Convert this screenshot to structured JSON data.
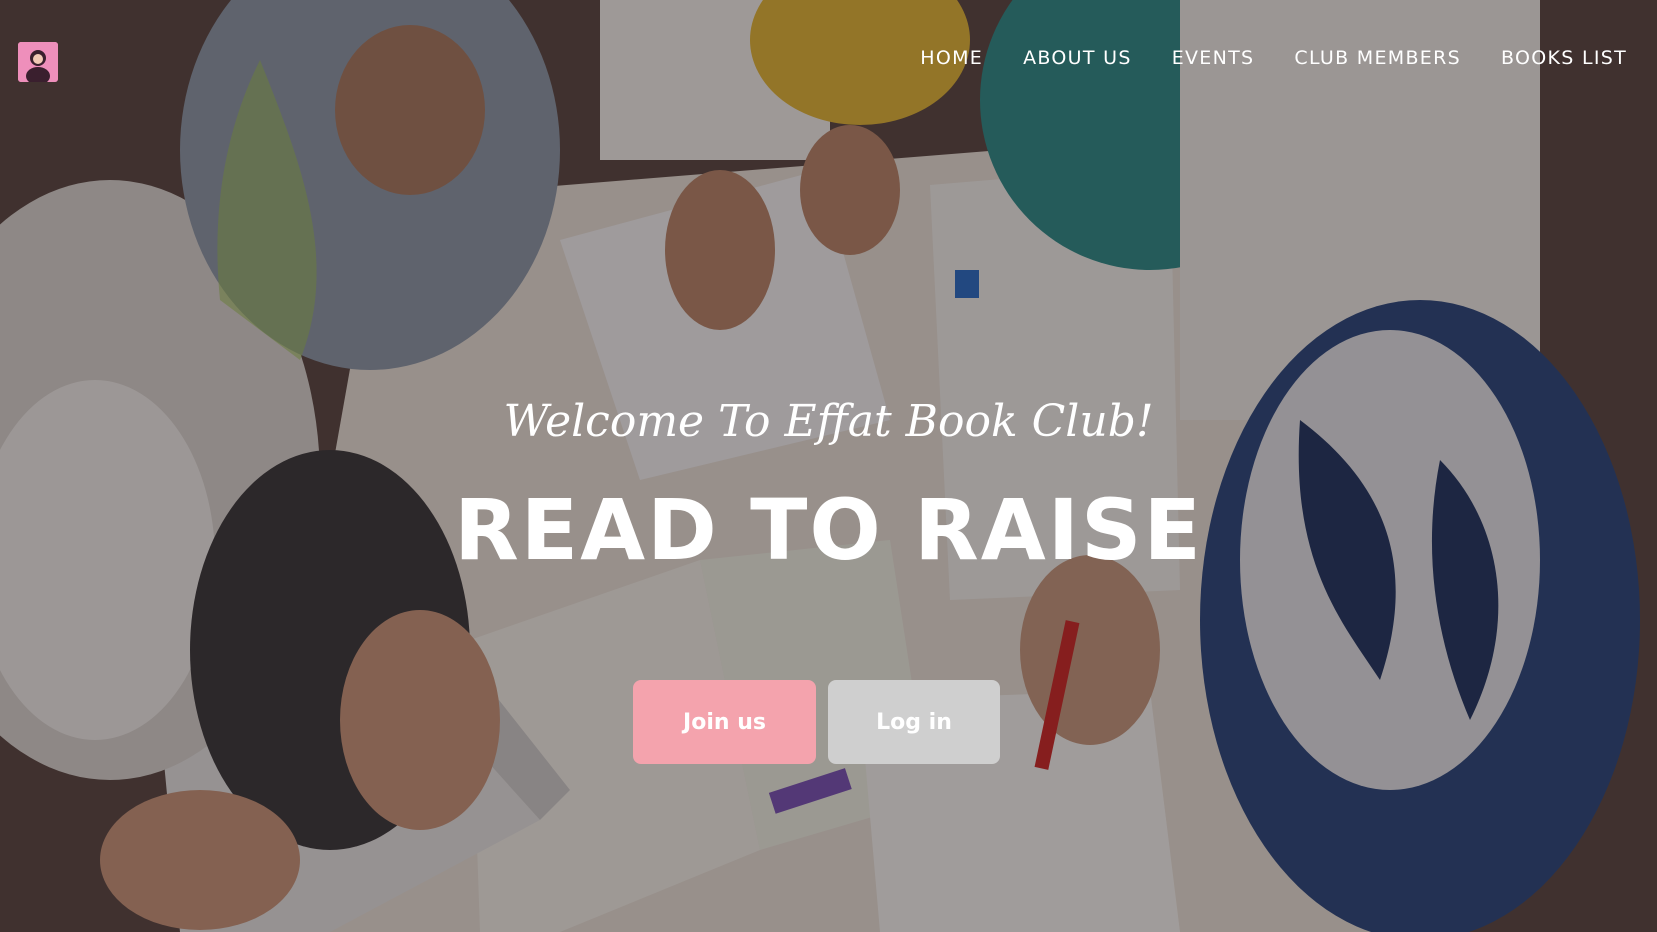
{
  "site": {
    "logo_icon": "profile-avatar-icon"
  },
  "nav": {
    "items": [
      {
        "label": "HOME"
      },
      {
        "label": "ABOUT US"
      },
      {
        "label": "EVENTS"
      },
      {
        "label": "CLUB MEMBERS"
      },
      {
        "label": "BOOKS LIST"
      }
    ]
  },
  "hero": {
    "welcome": "Welcome To Effat Book Club!",
    "headline": "READ TO RAISE",
    "join_label": "Join us",
    "login_label": "Log in"
  },
  "colors": {
    "join_button": "#f4a3ad",
    "login_button": "#cfcfcf",
    "text": "#ffffff"
  }
}
